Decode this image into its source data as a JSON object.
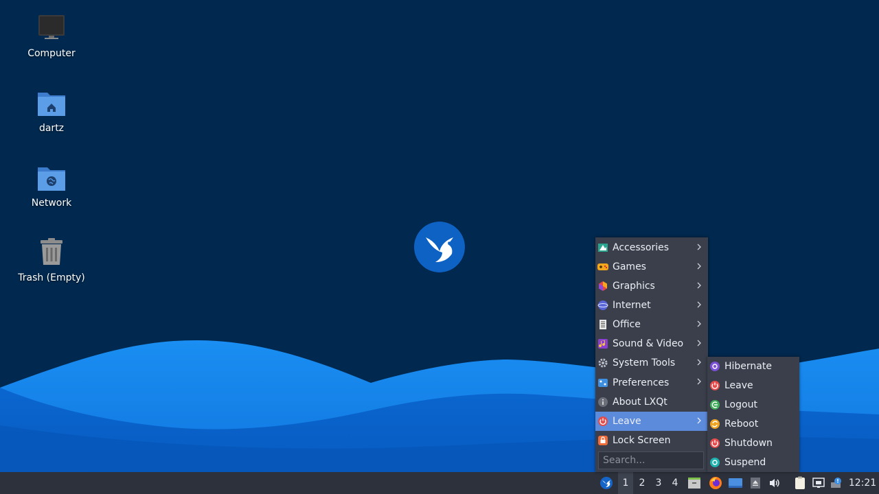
{
  "desktop": {
    "icons": [
      {
        "label": "Computer",
        "icon": "computer-icon"
      },
      {
        "label": "dartz",
        "icon": "home-folder-icon"
      },
      {
        "label": "Network",
        "icon": "network-folder-icon"
      },
      {
        "label": "Trash (Empty)",
        "icon": "trash-icon"
      }
    ]
  },
  "main_menu": {
    "items": [
      {
        "label": "Accessories",
        "icon": "accessories-icon",
        "submenu": true
      },
      {
        "label": "Games",
        "icon": "games-icon",
        "submenu": true
      },
      {
        "label": "Graphics",
        "icon": "graphics-icon",
        "submenu": true
      },
      {
        "label": "Internet",
        "icon": "internet-icon",
        "submenu": true
      },
      {
        "label": "Office",
        "icon": "office-icon",
        "submenu": true
      },
      {
        "label": "Sound & Video",
        "icon": "sound-video-icon",
        "submenu": true
      },
      {
        "label": "System Tools",
        "icon": "system-tools-icon",
        "submenu": true
      },
      {
        "label": "Preferences",
        "icon": "preferences-icon",
        "submenu": true
      },
      {
        "label": "About LXQt",
        "icon": "info-icon",
        "submenu": false
      },
      {
        "label": "Leave",
        "icon": "power-icon",
        "submenu": true,
        "active": true
      },
      {
        "label": "Lock Screen",
        "icon": "lock-icon",
        "submenu": false
      }
    ],
    "search_placeholder": "Search..."
  },
  "leave_submenu": {
    "items": [
      {
        "label": "Hibernate",
        "icon": "hibernate-icon"
      },
      {
        "label": "Leave",
        "icon": "power-icon"
      },
      {
        "label": "Logout",
        "icon": "logout-icon"
      },
      {
        "label": "Reboot",
        "icon": "reboot-icon"
      },
      {
        "label": "Shutdown",
        "icon": "shutdown-icon"
      },
      {
        "label": "Suspend",
        "icon": "suspend-icon"
      }
    ]
  },
  "panel": {
    "workspaces": [
      "1",
      "2",
      "3",
      "4"
    ],
    "current_workspace": "1",
    "clock": "12:21"
  },
  "colors": {
    "desktop_bg": "#01284e",
    "wave_light": "#1e8cf0",
    "wave_dark": "#0a6ad6",
    "menu_bg": "#3a3f4b",
    "menu_highlight": "#5d8bdc",
    "panel_bg": "#2d313b"
  }
}
